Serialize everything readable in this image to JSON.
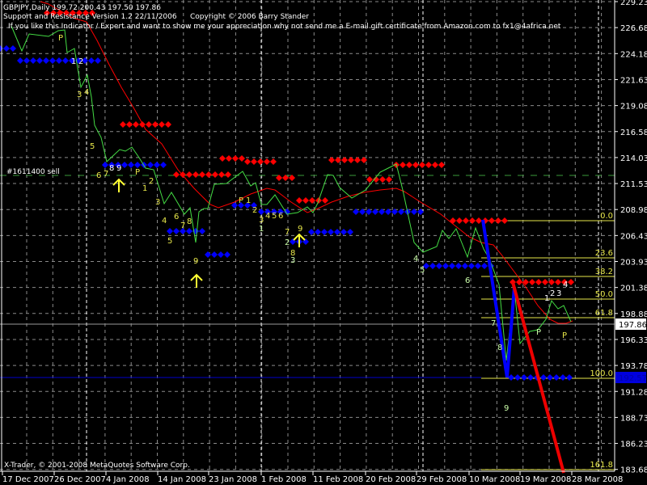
{
  "header": {
    "symbol_line": "GBPJPY,Daily  199.72 200.43 197.50 197.86",
    "indicator_line": "Support and Resistance  Version 1.2  22/11/2006",
    "copyright": "Copyright © 2006 Barry Stander",
    "message": "If you like this Indicator / Expert and want to show me your appreciation why not send me a   E-mail gift certificate   from Amazon.com to fx1@4africa.net"
  },
  "footer_copyright": "X-Trader, © 2001-2008 MetaQuotes Software Corp.",
  "order_label": "#1611400 sell",
  "price_axis": [
    "229.23",
    "226.68",
    "224.18",
    "221.63",
    "219.08",
    "216.58",
    "214.03",
    "211.53",
    "208.98",
    "206.43",
    "203.93",
    "201.38",
    "198.88",
    "196.33",
    "193.78",
    "191.28",
    "188.73",
    "186.23",
    "183.68"
  ],
  "current_price": "197.86",
  "line_price": "192.57",
  "time_axis": [
    "17 Dec 2007",
    "26 Dec 2007",
    "4 Jan 2008",
    "14 Jan 2008",
    "23 Jan 2008",
    "1 Feb 2008",
    "11 Feb 2008",
    "20 Feb 2008",
    "29 Feb 2008",
    "10 Mar 2008",
    "19 Mar 2008",
    "28 Mar 2008"
  ],
  "fibo_levels": [
    "0.0",
    "23.6",
    "38.2",
    "50.0",
    "61.8",
    "100.0",
    "161.8"
  ],
  "wave_labels": [
    "1",
    "2",
    "P",
    "3",
    "4",
    "5",
    "6",
    "7",
    "8",
    "9",
    "P",
    "1",
    "2",
    "3",
    "4",
    "6",
    "7",
    "8",
    "5",
    "9",
    "P",
    "1",
    "2",
    "3",
    "4",
    "5",
    "6",
    "7",
    "9",
    "8",
    "1",
    "2",
    "3",
    "4",
    "5",
    "6",
    "7",
    "8",
    "9",
    "1",
    "2",
    "3",
    "4",
    "P",
    "P"
  ],
  "colors": {
    "background": "#000000",
    "price_line": "#00ff00",
    "ma": "#ff0000",
    "support": "#0000ff",
    "resistance": "#ff0000",
    "fibo": "#ffff00",
    "grid": "#808080"
  }
}
